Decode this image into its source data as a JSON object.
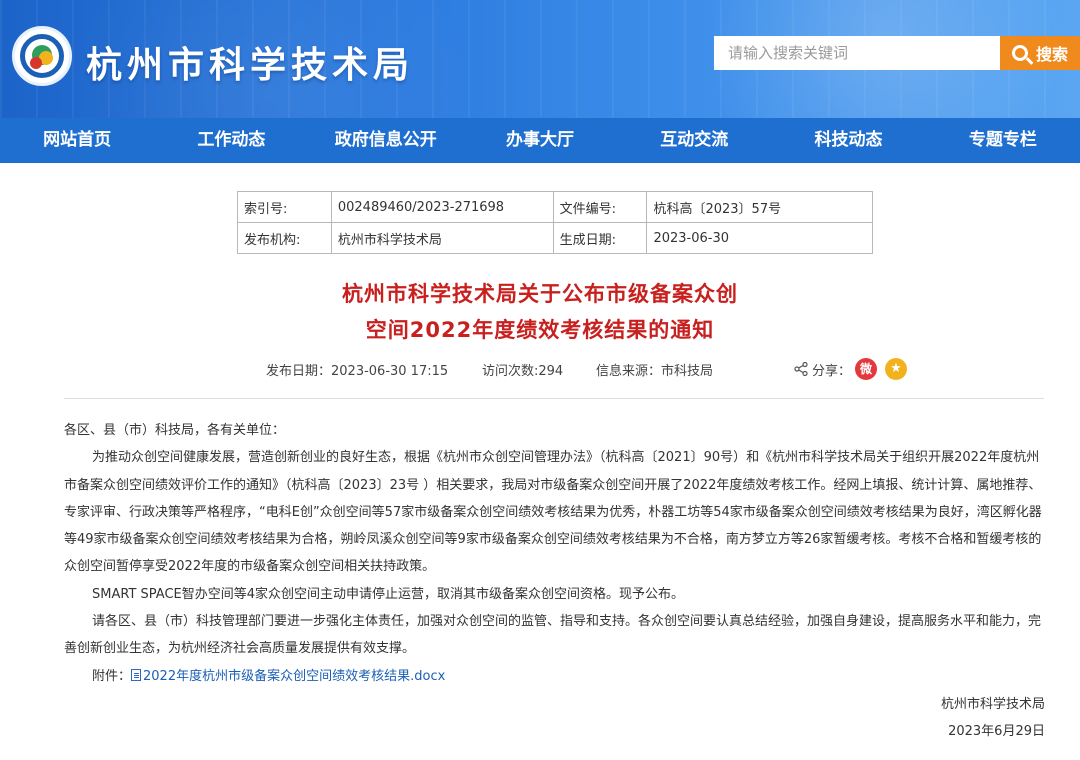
{
  "header": {
    "site_title": "杭州市科学技术局",
    "search_placeholder": "请输入搜索关键词",
    "search_button": "搜索"
  },
  "nav": {
    "items": [
      "网站首页",
      "工作动态",
      "政府信息公开",
      "办事大厅",
      "互动交流",
      "科技动态",
      "专题专栏"
    ]
  },
  "info": {
    "index_label": "索引号:",
    "index_value": "002489460/2023-271698",
    "doc_no_label": "文件编号:",
    "doc_no_value": "杭科高〔2023〕57号",
    "publisher_label": "发布机构:",
    "publisher_value": "杭州市科学技术局",
    "date_label": "生成日期:",
    "date_value": "2023-06-30"
  },
  "article": {
    "title_line1": "杭州市科学技术局关于公布市级备案众创",
    "title_line2": "空间2022年度绩效考核结果的通知",
    "publish_date": "发布日期：2023-06-30 17:15",
    "visits": "访问次数:294",
    "source": "信息来源：市科技局",
    "share_label": "分享：",
    "salutation": "各区、县（市）科技局，各有关单位：",
    "para1": "为推动众创空间健康发展，营造创新创业的良好生态，根据《杭州市众创空间管理办法》（杭科高〔2021〕90号）和《杭州市科学技术局关于组织开展2022年度杭州市备案众创空间绩效评价工作的通知》（杭科高〔2023〕23号 ）相关要求，我局对市级备案众创空间开展了2022年度绩效考核工作。经网上填报、统计计算、属地推荐、专家评审、行政决策等严格程序，“电科E创”众创空间等57家市级备案众创空间绩效考核结果为优秀，朴器工坊等54家市级备案众创空间绩效考核结果为良好，湾区孵化器等49家市级备案众创空间绩效考核结果为合格，朔岭凤溪众创空间等9家市级备案众创空间绩效考核结果为不合格，南方梦立方等26家暂缓考核。考核不合格和暂缓考核的众创空间暂停享受2022年度的市级备案众创空间相关扶持政策。",
    "para2": "SMART SPACE智办空间等4家众创空间主动申请停止运营，取消其市级备案众创空间资格。现予公布。",
    "para3": "请各区、县（市）科技管理部门要进一步强化主体责任，加强对众创空间的监管、指导和支持。各众创空间要认真总结经验，加强自身建设，提高服务水平和能力，完善创新创业生态，为杭州经济社会高质量发展提供有效支撑。",
    "attachment_label": "附件：",
    "attachment_link": "2022年度杭州市级备案众创空间绩效考核结果.docx",
    "signature": "杭州市科学技术局",
    "sign_date": "2023年6月29日"
  },
  "colors": {
    "nav_bg": "#1f6fd0",
    "title_red": "#c8201e",
    "search_orange": "#f08a1c",
    "link_blue": "#1b5fb6"
  },
  "icons": [
    "logo-emblem",
    "search-icon",
    "share-icon",
    "weibo-icon",
    "favorite-icon",
    "doc-icon"
  ]
}
